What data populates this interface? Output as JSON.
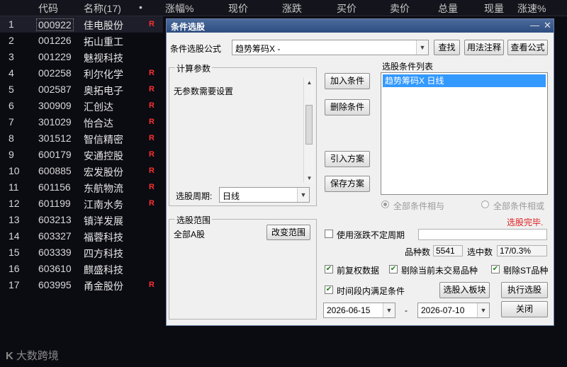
{
  "header": {
    "code": "代码",
    "name": "名称(17)",
    "dot": "•",
    "change_pct": "涨幅%",
    "price": "现价",
    "change": "涨跌",
    "bid": "买价",
    "ask": "卖价",
    "volume": "总量",
    "cur_volume": "现量",
    "speed": "涨速%"
  },
  "stocks": [
    {
      "idx": "1",
      "code": "000922",
      "name": "佳电股份",
      "flag": "R"
    },
    {
      "idx": "2",
      "code": "001226",
      "name": "拓山重工",
      "flag": ""
    },
    {
      "idx": "3",
      "code": "001229",
      "name": "魅视科技",
      "flag": ""
    },
    {
      "idx": "4",
      "code": "002258",
      "name": "利尔化学",
      "flag": "R"
    },
    {
      "idx": "5",
      "code": "002587",
      "name": "奥拓电子",
      "flag": "R"
    },
    {
      "idx": "6",
      "code": "300909",
      "name": "汇创达",
      "flag": "R"
    },
    {
      "idx": "7",
      "code": "301029",
      "name": "怡合达",
      "flag": "R"
    },
    {
      "idx": "8",
      "code": "301512",
      "name": "智信精密",
      "flag": "R"
    },
    {
      "idx": "9",
      "code": "600179",
      "name": "安通控股",
      "flag": "R"
    },
    {
      "idx": "10",
      "code": "600885",
      "name": "宏发股份",
      "flag": "R"
    },
    {
      "idx": "11",
      "code": "601156",
      "name": "东航物流",
      "flag": "R"
    },
    {
      "idx": "12",
      "code": "601199",
      "name": "江南水务",
      "flag": "R"
    },
    {
      "idx": "13",
      "code": "603213",
      "name": "镇洋发展",
      "flag": ""
    },
    {
      "idx": "14",
      "code": "603327",
      "name": "福蓉科技",
      "flag": ""
    },
    {
      "idx": "15",
      "code": "603339",
      "name": "四方科技",
      "flag": ""
    },
    {
      "idx": "16",
      "code": "603610",
      "name": "麒盛科技",
      "flag": ""
    },
    {
      "idx": "17",
      "code": "603995",
      "name": "甬金股份",
      "flag": "R"
    }
  ],
  "watermark": {
    "logo": "K",
    "text": "大数跨境"
  },
  "dialog": {
    "title": "条件选股",
    "formula_label": "条件选股公式",
    "formula_value": "趋势筹码X  -",
    "find_btn": "查找",
    "usage_btn": "用法注释",
    "view_formula_btn": "查看公式",
    "params_group": "计算参数",
    "params_text": "无参数需要设置",
    "period_label": "选股周期:",
    "period_value": "日线",
    "add_cond_btn": "加入条件",
    "del_cond_btn": "删除条件",
    "import_btn": "引入方案",
    "save_btn": "保存方案",
    "cond_list_label": "选股条件列表",
    "cond_list_item": "趋势筹码X  日线",
    "radio_and": "全部条件相与",
    "radio_or": "全部条件相或",
    "status": "选股完毕.",
    "range_group": "选股范围",
    "range_value": "全部A股",
    "change_range_btn": "改变范围",
    "use_change_label": "使用涨跌不定周期",
    "count_label": "品种数",
    "count_value": "5541",
    "selected_label": "选中数",
    "selected_value": "17/0.3%",
    "fq_label": "前复权数据",
    "exclude_label": "剔除当前未交易品种",
    "exclude_st_label": "剔除ST品种",
    "time_label": "时间段内满足条件",
    "to_block_btn": "选股入板块",
    "exec_btn": "执行选股",
    "date_from": "2026-06-15",
    "date_sep": "-",
    "date_to": "2026-07-10",
    "close_btn": "关闭",
    "minimize": "—",
    "close_x": "✕"
  }
}
